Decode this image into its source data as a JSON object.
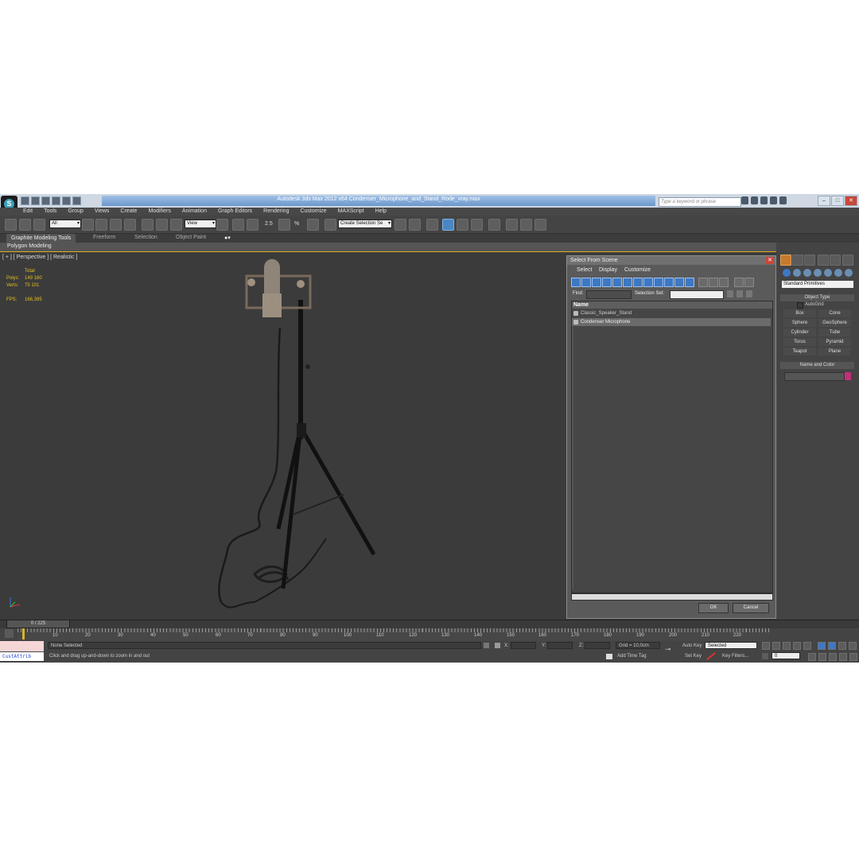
{
  "app": {
    "title": "Autodesk 3ds Max  2012 x64     Condenser_Microphone_and_Stand_Rode_vray.max",
    "search_placeholder": "Type a keyword or phrase",
    "logo": "3ds-max-logo"
  },
  "menu": [
    "Edit",
    "Tools",
    "Group",
    "Views",
    "Create",
    "Modifiers",
    "Animation",
    "Graph Editors",
    "Rendering",
    "Customize",
    "MAXScript",
    "Help"
  ],
  "toolbar": {
    "selection_filter": "All",
    "ref_coord": "View",
    "named_selection": "Create Selection Se",
    "snap_values": [
      "2.5",
      "%"
    ]
  },
  "ribbon": {
    "tabs": [
      "Graphite Modeling Tools",
      "Freeform",
      "Selection",
      "Object Paint"
    ],
    "panel": "Polygon Modeling"
  },
  "viewport": {
    "label": "[ + ] [ Perspective ] [ Realistic ]",
    "stats": {
      "total_label": "Total",
      "polys_label": "Polys:",
      "polys_value": "149 160",
      "verts_label": "Verts:",
      "verts_value": "75 101",
      "fps_label": "FPS:",
      "fps_value": "166,395"
    }
  },
  "select_dialog": {
    "title": "Select From Scene",
    "menu": [
      "Select",
      "Display",
      "Customize"
    ],
    "find_label": "Find:",
    "selection_set_label": "Selection Set:",
    "column_header": "Name",
    "rows": [
      "Classic_Speaker_Stand",
      "Condenser Microphone"
    ],
    "ok": "OK",
    "cancel": "Cancel"
  },
  "command_panel": {
    "category": "Standard Primitives",
    "object_type_title": "Object Type",
    "autogrid": "AutoGrid",
    "buttons": [
      "Box",
      "Cone",
      "Sphere",
      "GeoSphere",
      "Cylinder",
      "Tube",
      "Torus",
      "Pyramid",
      "Teapot",
      "Plane"
    ],
    "name_color_title": "Name and Color",
    "object_color": "#c2307a"
  },
  "timeline": {
    "frame": "0 / 225",
    "ticks": [
      "10",
      "20",
      "30",
      "40",
      "50",
      "60",
      "70",
      "80",
      "90",
      "100",
      "110",
      "120",
      "130",
      "140",
      "150",
      "160",
      "170",
      "180",
      "190",
      "200",
      "210",
      "220"
    ]
  },
  "status": {
    "maxscript": "CustAttrib",
    "selection": "None Selected",
    "prompt": "Click and drag up-and-down to zoom in and out",
    "x_label": "X:",
    "y_label": "Y:",
    "z_label": "Z:",
    "grid": "Grid = 10,0cm",
    "add_time_tag": "Add Time Tag",
    "auto_key": "Auto Key",
    "auto_key_mode": "Selected",
    "set_key": "Set Key",
    "key_filters": "Key Filters...",
    "current_frame": "0"
  }
}
